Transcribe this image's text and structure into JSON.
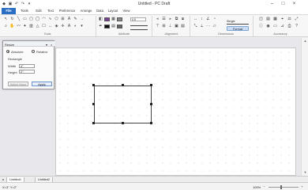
{
  "window": {
    "title": "Untitled - PC Draft"
  },
  "quick_access": [
    {
      "icon": "pcdraft-app-icon"
    },
    {
      "icon": "save-icon"
    },
    {
      "icon": "undo-icon"
    },
    {
      "icon": "redo-icon"
    },
    {
      "icon": "customize-dropdown-icon"
    }
  ],
  "window_controls": [
    {
      "icon": "minimize-icon",
      "glyph": "–"
    },
    {
      "icon": "maximize-icon",
      "glyph": "□"
    },
    {
      "icon": "close-icon",
      "glyph": "×"
    }
  ],
  "ribbon_tabs": [
    "File",
    "Tools",
    "Edit",
    "Text",
    "Preference",
    "Arrange",
    "Data",
    "Layout",
    "View"
  ],
  "ribbon_groups": {
    "tools": "Tools",
    "attribute": "Attribute",
    "alignment": "Alignment",
    "dimensions": "Dimensions",
    "accessory": "Accessory"
  },
  "attribute": {
    "fill_color": "#7b3f98",
    "pen_color": "#111111",
    "line_width": "0.5"
  },
  "dimensions": {
    "mode": "Single",
    "format_label": "Format"
  },
  "resize_panel": {
    "title": "Resize",
    "absolute_label": "Absolute",
    "relative_label": "Relative",
    "shape_label": "Rectangle",
    "width_label": "Width",
    "width_value": "4\"",
    "height_label": "Height",
    "height_value": "2\"",
    "select_none_label": "Select None",
    "apply_label": "Apply"
  },
  "page_tabs": [
    "Untitled1",
    "Untitled2"
  ],
  "status": {
    "coords": "X=3\" Y=2\"",
    "zoom": "100%"
  }
}
